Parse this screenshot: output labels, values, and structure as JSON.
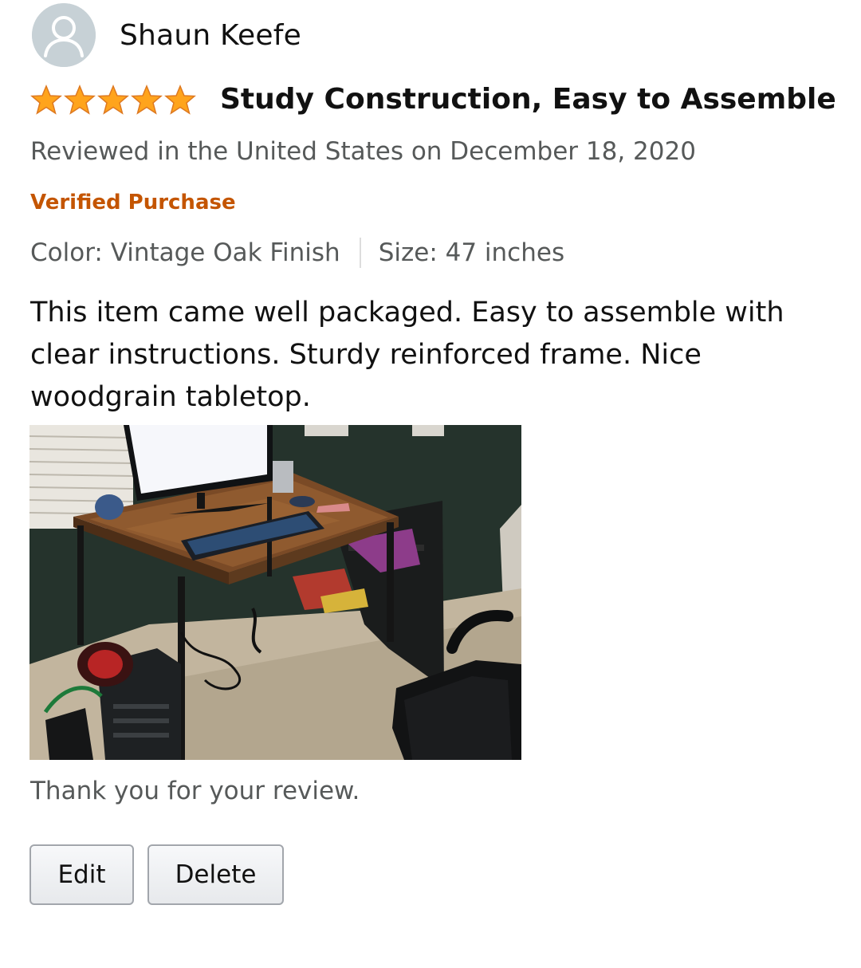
{
  "reviewer": {
    "name": "Shaun Keefe",
    "avatar_icon": "default-profile-icon"
  },
  "review": {
    "rating": 5,
    "rating_max": 5,
    "star_color": "#ffa41c",
    "title": "Study Construction, Easy to Assemble",
    "date_text": "Reviewed in the United States on December 18, 2020",
    "verified_label": "Verified Purchase",
    "verified_color": "#c45500",
    "color_variant": "Color: Vintage Oak Finish",
    "size_variant": "Size: 47 inches",
    "body": "This item came well packaged. Easy to assemble with clear instructions. Sturdy reinforced frame. Nice woodgrain tabletop."
  },
  "footer": {
    "thanks_text": "Thank you for your review.",
    "edit_label": "Edit",
    "delete_label": "Delete"
  }
}
